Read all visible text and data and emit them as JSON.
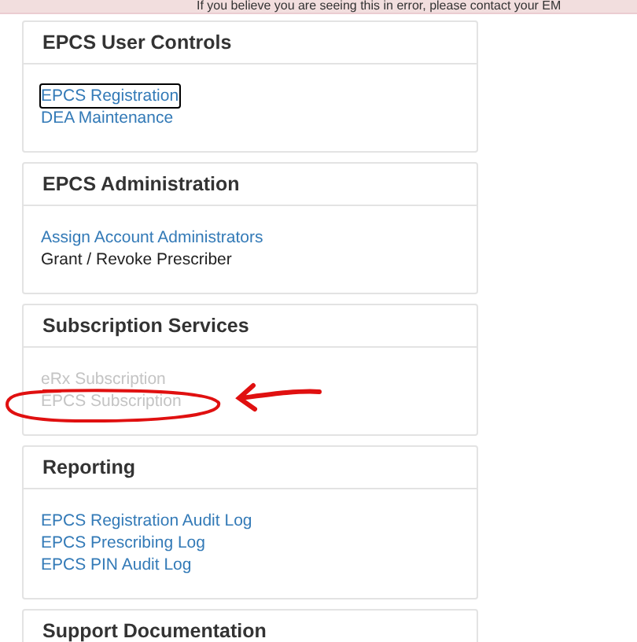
{
  "banner": {
    "text": "If you believe you are seeing this in error, please contact your EM"
  },
  "panels": [
    {
      "title": "EPCS User Controls",
      "items": [
        {
          "label": "EPCS Registration",
          "kind": "link",
          "focused": true
        },
        {
          "label": "DEA Maintenance",
          "kind": "link",
          "focused": false
        }
      ]
    },
    {
      "title": "EPCS Administration",
      "items": [
        {
          "label": "Assign Account Administrators",
          "kind": "link",
          "focused": false
        },
        {
          "label": "Grant / Revoke Prescriber",
          "kind": "plain",
          "focused": false
        }
      ]
    },
    {
      "title": "Subscription Services",
      "annotated": true,
      "items": [
        {
          "label": "eRx Subscription",
          "kind": "disabled",
          "focused": false
        },
        {
          "label": "EPCS Subscription",
          "kind": "disabled",
          "focused": false
        }
      ]
    },
    {
      "title": "Reporting",
      "items": [
        {
          "label": "EPCS Registration Audit Log",
          "kind": "link",
          "focused": false
        },
        {
          "label": "EPCS Prescribing Log",
          "kind": "link",
          "focused": false
        },
        {
          "label": "EPCS PIN Audit Log",
          "kind": "link",
          "focused": false
        }
      ]
    },
    {
      "title": "Support Documentation"
    }
  ]
}
